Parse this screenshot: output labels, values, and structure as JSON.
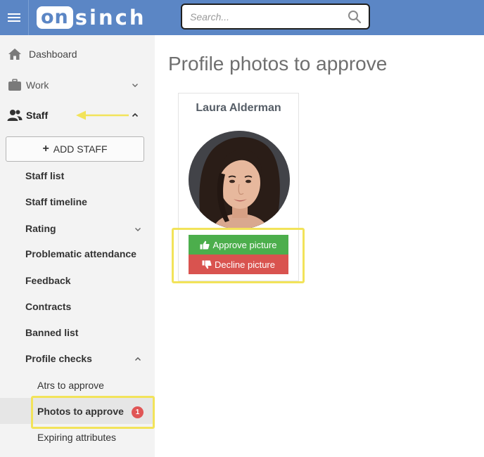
{
  "header": {
    "logo_left": "on",
    "logo_right": "sinch",
    "search_placeholder": "Search..."
  },
  "sidebar": {
    "dashboard": "Dashboard",
    "work": "Work",
    "staff": "Staff",
    "add_staff": "ADD STAFF",
    "staff_items": [
      "Staff list",
      "Staff timeline",
      "Rating",
      "Problematic attendance",
      "Feedback",
      "Contracts",
      "Banned list",
      "Profile checks"
    ],
    "profile_checks_items": [
      "Atrs to approve",
      "Photos to approve",
      "Expiring attributes"
    ],
    "photos_badge": "1"
  },
  "main": {
    "title": "Profile photos to approve",
    "card": {
      "name": "Laura Alderman",
      "approve_label": "Approve picture",
      "decline_label": "Decline picture"
    }
  },
  "colors": {
    "topbar": "#5b86c5",
    "approve": "#4cae4c",
    "decline": "#d9534f",
    "highlight": "#f2e35a",
    "badge": "#e05555"
  }
}
